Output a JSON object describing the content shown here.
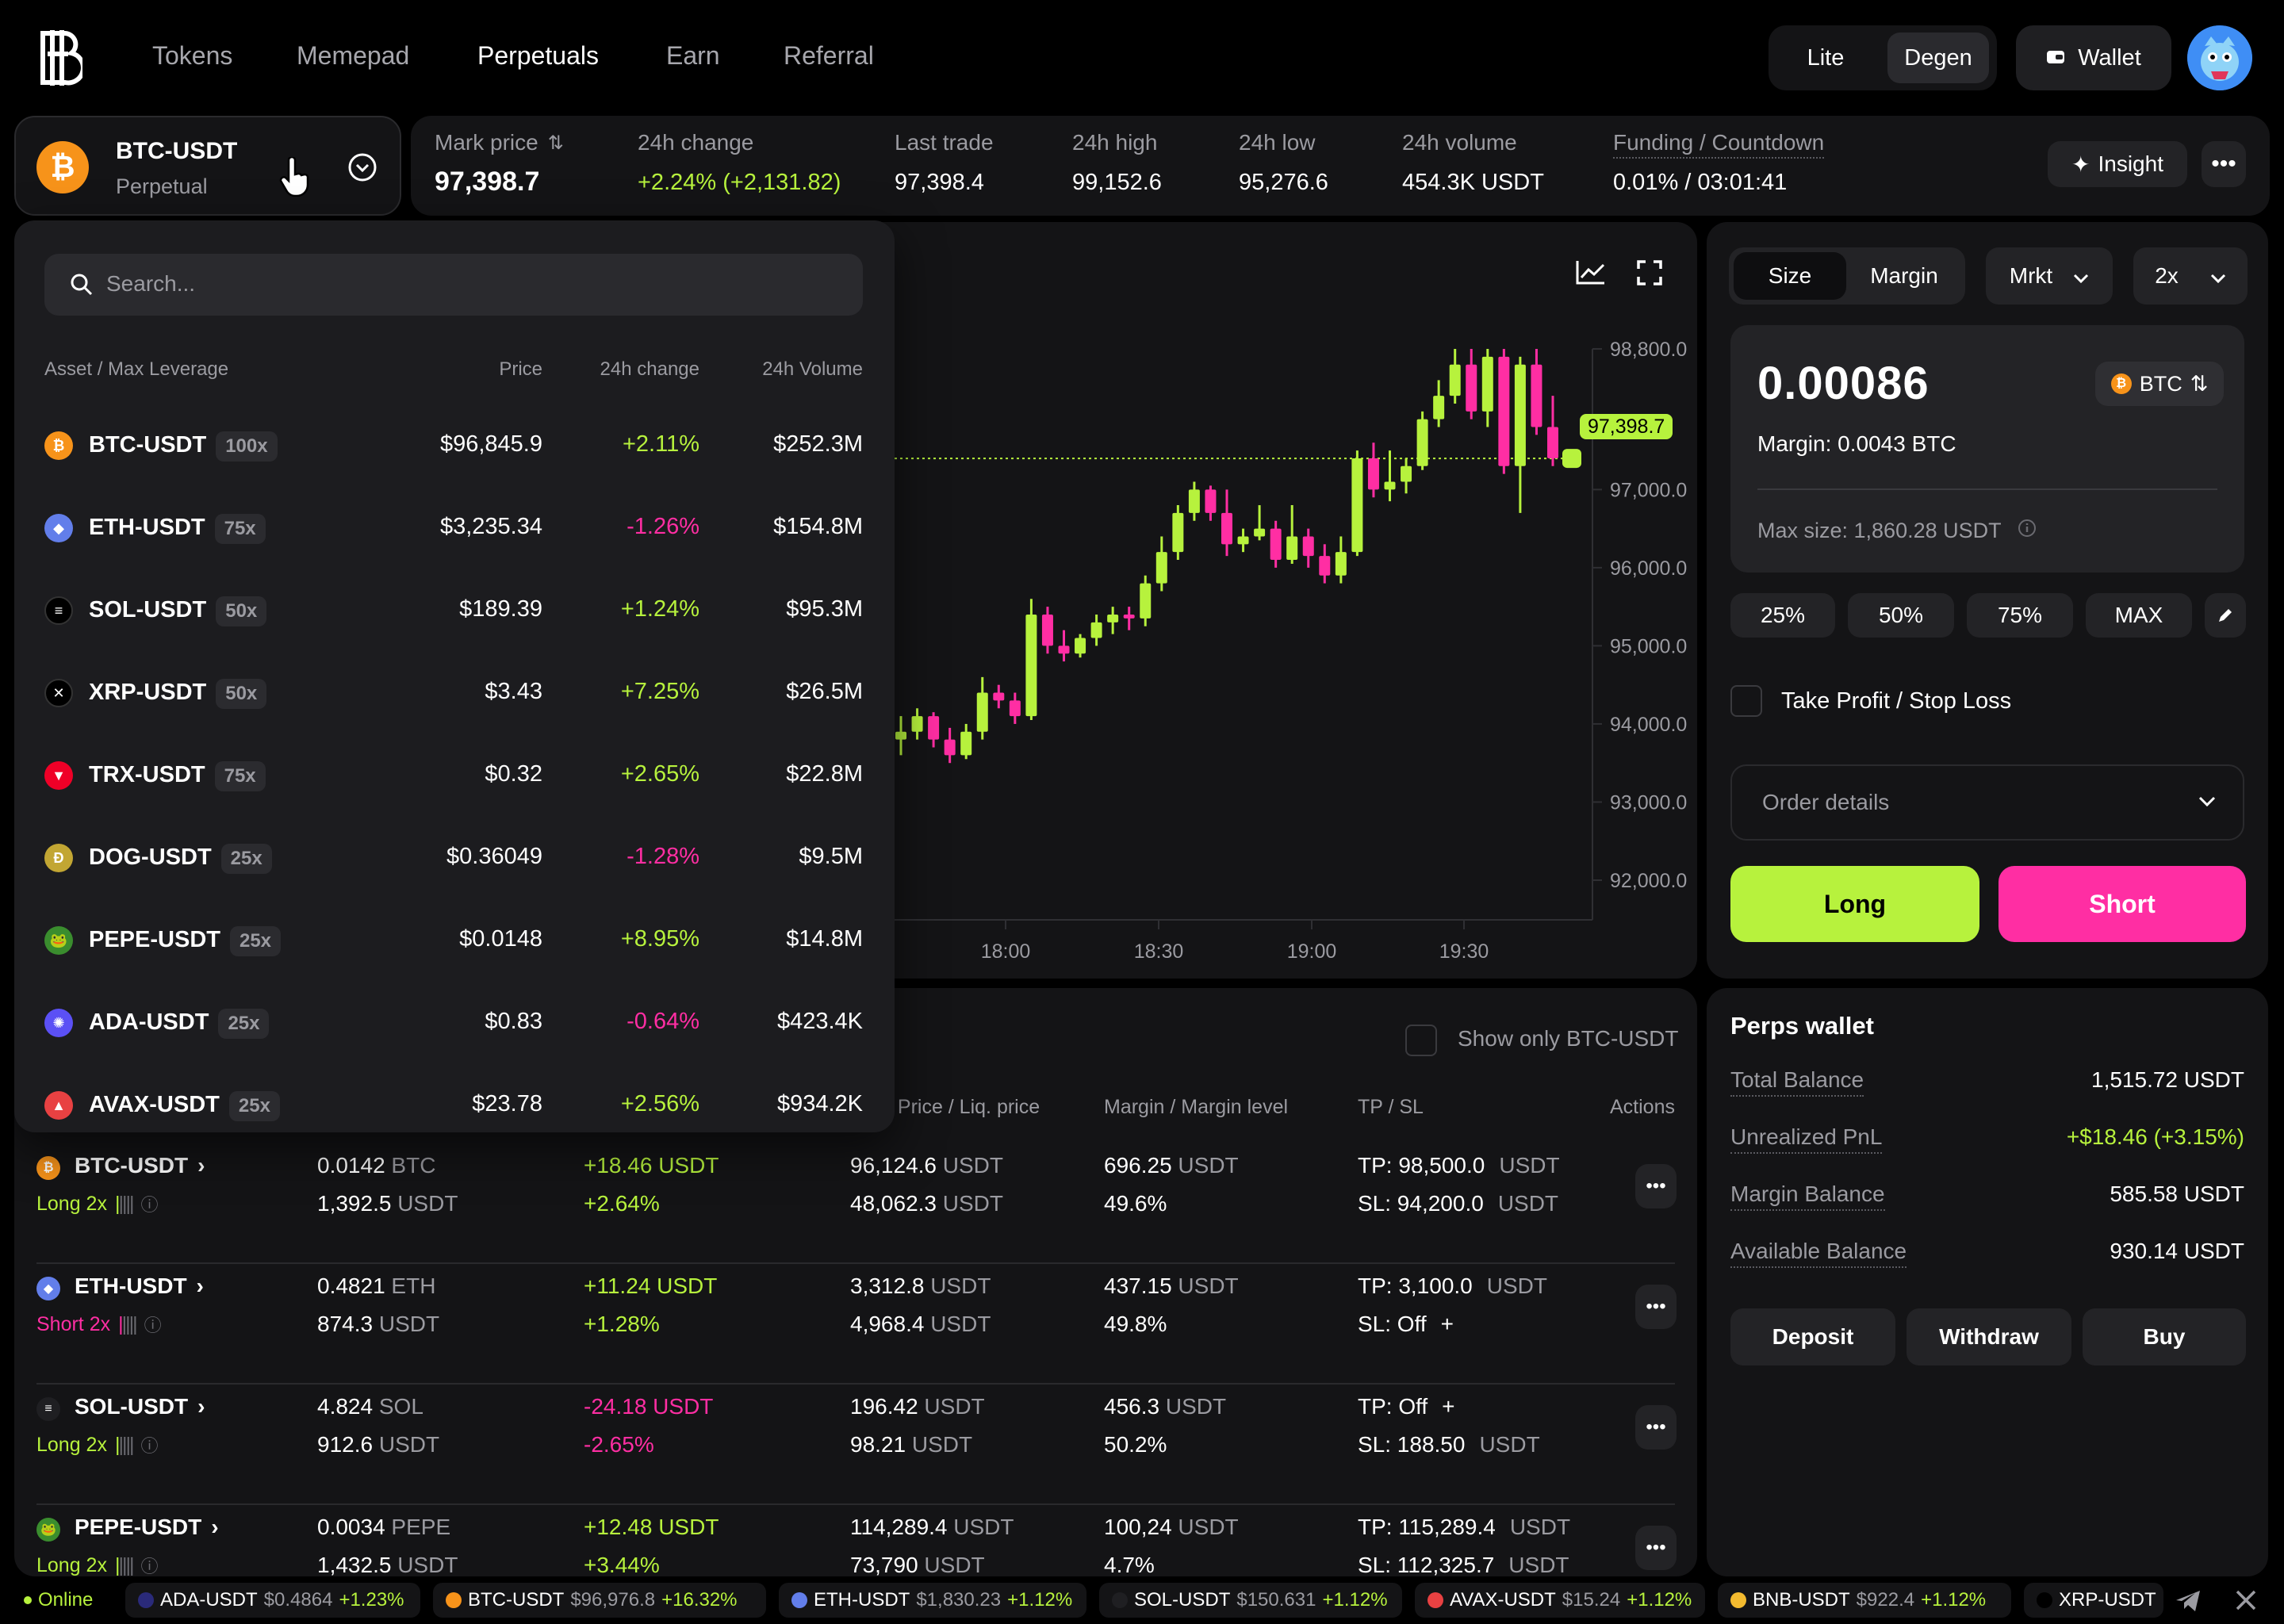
{
  "nav": {
    "links": [
      "Tokens",
      "Memepad",
      "Perpetuals",
      "Earn",
      "Referral"
    ],
    "active": "Perpetuals",
    "mode_options": [
      "Lite",
      "Degen"
    ],
    "mode_selected": "Degen",
    "wallet_label": "Wallet"
  },
  "pair": {
    "symbol": "BTC-USDT",
    "type": "Perpetual"
  },
  "stats": [
    {
      "label": "Mark price",
      "value": "97,398.7"
    },
    {
      "label": "24h change",
      "value": "+2.24% (+2,131.82)"
    },
    {
      "label": "Last trade",
      "value": "97,398.4"
    },
    {
      "label": "24h high",
      "value": "99,152.6"
    },
    {
      "label": "24h low",
      "value": "95,276.6"
    },
    {
      "label": "24h volume",
      "value": "454.3K USDT"
    },
    {
      "label": "Funding / Countdown",
      "value": "0.01% / 03:01:41"
    }
  ],
  "insight_label": "Insight",
  "dropdown": {
    "search_placeholder": "Search...",
    "headers": [
      "Asset / Max Leverage",
      "Price",
      "24h change",
      "24h Volume"
    ],
    "assets": [
      {
        "symbol": "BTC-USDT",
        "lev": "100x",
        "price": "$96,845.9",
        "change": "+2.11%",
        "volume": "$252.3M",
        "icon": "bitcoin-icon",
        "color": "#f7931a"
      },
      {
        "symbol": "ETH-USDT",
        "lev": "75x",
        "price": "$3,235.34",
        "change": "-1.26%",
        "volume": "$154.8M",
        "icon": "ethereum-icon",
        "color": "#627eea"
      },
      {
        "symbol": "SOL-USDT",
        "lev": "50x",
        "price": "$189.39",
        "change": "+1.24%",
        "volume": "$95.3M",
        "icon": "solana-icon",
        "color": "#000000"
      },
      {
        "symbol": "XRP-USDT",
        "lev": "50x",
        "price": "$3.43",
        "change": "+7.25%",
        "volume": "$26.5M",
        "icon": "xrp-icon",
        "color": "#000000"
      },
      {
        "symbol": "TRX-USDT",
        "lev": "75x",
        "price": "$0.32",
        "change": "+2.65%",
        "volume": "$22.8M",
        "icon": "tron-icon",
        "color": "#ef0027"
      },
      {
        "symbol": "DOG-USDT",
        "lev": "25x",
        "price": "$0.36049",
        "change": "-1.28%",
        "volume": "$9.5M",
        "icon": "doge-icon",
        "color": "#c2a633"
      },
      {
        "symbol": "PEPE-USDT",
        "lev": "25x",
        "price": "$0.0148",
        "change": "+8.95%",
        "volume": "$14.8M",
        "icon": "pepe-icon",
        "color": "#3a8d2e"
      },
      {
        "symbol": "ADA-USDT",
        "lev": "25x",
        "price": "$0.83",
        "change": "-0.64%",
        "volume": "$423.4K",
        "icon": "cardano-icon",
        "color": "#5b50f5"
      },
      {
        "symbol": "AVAX-USDT",
        "lev": "25x",
        "price": "$23.78",
        "change": "+2.56%",
        "volume": "$934.2K",
        "icon": "avalanche-icon",
        "color": "#e84142"
      }
    ]
  },
  "chart_data": {
    "type": "candlestick",
    "y_ticks": [
      "98,800.0",
      "97,000.0",
      "96,000.0",
      "95,000.0",
      "94,000.0",
      "93,000.0",
      "92,000.0"
    ],
    "x_ticks": [
      "18:00",
      "18:30",
      "19:00",
      "19:30"
    ],
    "ylim": [
      92000,
      98800
    ],
    "last_price_label": "97,398.7",
    "last_price": 97398.7,
    "candles": [
      [
        93800,
        94100,
        93600,
        93900
      ],
      [
        93900,
        94200,
        93800,
        94100
      ],
      [
        94100,
        94150,
        93700,
        93800
      ],
      [
        93800,
        93950,
        93500,
        93600
      ],
      [
        93600,
        94000,
        93550,
        93900
      ],
      [
        93900,
        94600,
        93800,
        94400
      ],
      [
        94400,
        94500,
        94200,
        94300
      ],
      [
        94300,
        94400,
        94000,
        94100
      ],
      [
        94100,
        95600,
        94050,
        95400
      ],
      [
        95400,
        95500,
        94900,
        95000
      ],
      [
        95000,
        95200,
        94800,
        94900
      ],
      [
        94900,
        95150,
        94850,
        95100
      ],
      [
        95100,
        95400,
        95000,
        95300
      ],
      [
        95300,
        95500,
        95150,
        95400
      ],
      [
        95400,
        95500,
        95200,
        95350
      ],
      [
        95350,
        95900,
        95250,
        95800
      ],
      [
        95800,
        96400,
        95700,
        96200
      ],
      [
        96200,
        96800,
        96100,
        96700
      ],
      [
        96700,
        97100,
        96600,
        97000
      ],
      [
        97000,
        97050,
        96600,
        96700
      ],
      [
        96700,
        97000,
        96150,
        96300
      ],
      [
        96300,
        96500,
        96200,
        96400
      ],
      [
        96400,
        96800,
        96350,
        96500
      ],
      [
        96500,
        96600,
        96000,
        96100
      ],
      [
        96100,
        96800,
        96050,
        96400
      ],
      [
        96400,
        96500,
        96000,
        96150
      ],
      [
        96150,
        96300,
        95800,
        95900
      ],
      [
        95900,
        96400,
        95800,
        96200
      ],
      [
        96200,
        97500,
        96150,
        97400
      ],
      [
        97400,
        97600,
        96900,
        97000
      ],
      [
        97000,
        97500,
        96850,
        97100
      ],
      [
        97100,
        97400,
        96950,
        97300
      ],
      [
        97300,
        98000,
        97250,
        97900
      ],
      [
        97900,
        98400,
        97800,
        98200
      ],
      [
        98200,
        98800,
        98100,
        98600
      ],
      [
        98600,
        98800,
        97900,
        98000
      ],
      [
        98000,
        98800,
        97800,
        98700
      ],
      [
        98700,
        98800,
        97200,
        97300
      ],
      [
        97300,
        98700,
        96700,
        98600
      ],
      [
        98600,
        98800,
        97700,
        97800
      ],
      [
        97800,
        98200,
        97300,
        97400
      ]
    ]
  },
  "order": {
    "tabs": [
      "Size",
      "Margin"
    ],
    "tab_selected": "Size",
    "order_type": "Mrkt",
    "leverage": "2x",
    "amount": "0.00086",
    "unit": "BTC",
    "margin": "Margin: 0.0043 BTC",
    "max_size": "Max size: 1,860.28 USDT",
    "pct": [
      "25%",
      "50%",
      "75%",
      "MAX"
    ],
    "tpsl": "Take Profit / Stop Loss",
    "details": "Order details",
    "long": "Long",
    "short": "Short"
  },
  "positions": {
    "show_only": "Show only BTC-USDT",
    "headers": [
      "/ Price / Liq. price",
      "Margin / Margin level",
      "TP / SL",
      "Actions"
    ],
    "rows": [
      {
        "symbol": "BTC-USDT",
        "side": "Long 2x",
        "sidecolor": "#b7f23d",
        "size1": "0.0142",
        "size1u": "BTC",
        "size2": "1,392.5",
        "size2u": "USDT",
        "pnl1": "+18.46 USDT",
        "pnl2": "+2.64%",
        "pnlcolor": "#b7f23d",
        "price1": "96,124.6",
        "price2": "48,062.3",
        "m1": "696.25",
        "m2": "49.6%",
        "tp": "TP: 98,500.0",
        "sl": "SL: 94,200.0",
        "icon": "bitcoin-icon",
        "color": "#f7931a"
      },
      {
        "symbol": "ETH-USDT",
        "side": "Short 2x",
        "sidecolor": "#ff2ea3",
        "size1": "0.4821",
        "size1u": "ETH",
        "size2": "874.3",
        "size2u": "USDT",
        "pnl1": "+11.24 USDT",
        "pnl2": "+1.28%",
        "pnlcolor": "#b7f23d",
        "price1": "3,312.8",
        "price2": "4,968.4",
        "m1": "437.15",
        "m2": "49.8%",
        "tp": "TP: 3,100.0",
        "sl": "SL: Off",
        "icon": "ethereum-icon",
        "color": "#627eea"
      },
      {
        "symbol": "SOL-USDT",
        "side": "Long 2x",
        "sidecolor": "#b7f23d",
        "size1": "4.824",
        "size1u": "SOL",
        "size2": "912.6",
        "size2u": "USDT",
        "pnl1": "-24.18 USDT",
        "pnl2": "-2.65%",
        "pnlcolor": "#ff2ea3",
        "price1": "196.42",
        "price2": "98.21",
        "m1": "456.3",
        "m2": "50.2%",
        "tp": "TP: Off",
        "sl": "SL: 188.50",
        "icon": "solana-icon",
        "color": "#1f1f22"
      },
      {
        "symbol": "PEPE-USDT",
        "side": "Long 2x",
        "sidecolor": "#b7f23d",
        "size1": "0.0034",
        "size1u": "PEPE",
        "size2": "1,432.5",
        "size2u": "USDT",
        "pnl1": "+12.48 USDT",
        "pnl2": "+3.44%",
        "pnlcolor": "#b7f23d",
        "price1": "114,289.4",
        "price2": "73,790",
        "m1": "100,24",
        "m2": "4.7%",
        "tp": "TP: 115,289.4",
        "sl": "SL: 112,325.7",
        "icon": "pepe-icon",
        "color": "#3a8d2e"
      }
    ],
    "unit": "USDT"
  },
  "wallet": {
    "title": "Perps wallet",
    "rows": [
      {
        "label": "Total Balance",
        "value": "1,515.72 USDT",
        "color": "#ffffff"
      },
      {
        "label": "Unrealized PnL",
        "value": "+$18.46 (+3.15%)",
        "color": "#b7f23d"
      },
      {
        "label": "Margin Balance",
        "value": "585.58 USDT",
        "color": "#ffffff"
      },
      {
        "label": "Available Balance",
        "value": "930.14 USDT",
        "color": "#ffffff"
      }
    ],
    "buttons": [
      "Deposit",
      "Withdraw",
      "Buy"
    ]
  },
  "ticker": {
    "status": "Online",
    "items": [
      {
        "sym": "ADA-USDT",
        "price": "$0.4864",
        "chg": "+1.23%",
        "color": "#2a2a7a"
      },
      {
        "sym": "BTC-USDT",
        "price": "$96,976.8",
        "chg": "+16.32%",
        "color": "#f7931a"
      },
      {
        "sym": "ETH-USDT",
        "price": "$1,830.23",
        "chg": "+1.12%",
        "color": "#627eea"
      },
      {
        "sym": "SOL-USDT",
        "price": "$150.631",
        "chg": "+1.12%",
        "color": "#1f1f22"
      },
      {
        "sym": "AVAX-USDT",
        "price": "$15.24",
        "chg": "+1.12%",
        "color": "#e84142"
      },
      {
        "sym": "BNB-USDT",
        "price": "$922.4",
        "chg": "+1.12%",
        "color": "#f3ba2f"
      },
      {
        "sym": "XRP-USDT",
        "price": "",
        "chg": "",
        "color": "#000000"
      }
    ]
  }
}
